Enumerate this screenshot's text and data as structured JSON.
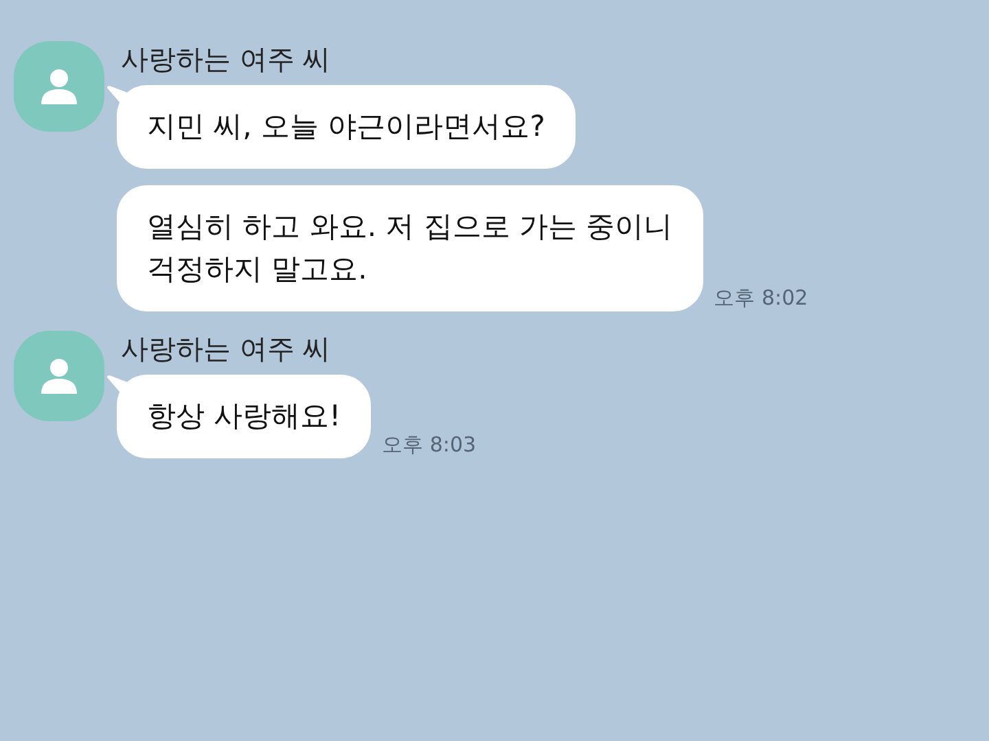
{
  "groups": [
    {
      "sender": "사랑하는 여주 씨",
      "messages": [
        {
          "text": "지민 씨, 오늘 야근이라면서요?"
        },
        {
          "text": "열심히 하고 와요. 저 집으로 가는 중이니\n걱정하지 말고요.",
          "time": "오후 8:02"
        }
      ]
    },
    {
      "sender": "사랑하는 여주 씨",
      "messages": [
        {
          "text": "항상 사랑해요!",
          "time": "오후 8:03"
        }
      ]
    }
  ]
}
